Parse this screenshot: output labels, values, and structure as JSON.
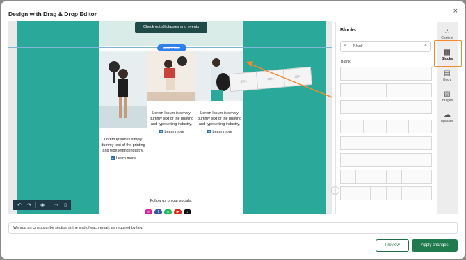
{
  "dialog": {
    "title": "Design with Drag & Drop Editor",
    "close": "×"
  },
  "email": {
    "cta_label": "Check out all classes and events",
    "drop_label": "Drop it here",
    "columns": [
      {
        "text": "Lorem Ipsum is simply dummy text of the printing and typesetting industry.",
        "link": "Learn more"
      },
      {
        "text": "Lorem Ipsum is simply dummy text of the printing and typesetting industry.",
        "link": "Learn more"
      },
      {
        "text": "Lorem Ipsum is simply dummy text of the printing and typesetting industry.",
        "link": "Learn more"
      }
    ],
    "follow_text": "Follow us on our socials:",
    "socials": [
      {
        "name": "instagram-icon",
        "color": "#d6249f"
      },
      {
        "name": "facebook-icon",
        "color": "#3b5998"
      },
      {
        "name": "spotify-icon",
        "color": "#1db954"
      },
      {
        "name": "youtube-icon",
        "color": "#e62117"
      },
      {
        "name": "tiktok-icon",
        "color": "#111111"
      }
    ]
  },
  "drag_ghost": {
    "cells": [
      "33%",
      "33%",
      "33%"
    ]
  },
  "toolbar": {
    "icons": [
      "undo-icon",
      "redo-icon",
      "preview-eye-icon",
      "desktop-icon",
      "mobile-icon"
    ]
  },
  "blocks_panel": {
    "title": "Blocks",
    "search_value": "Blank",
    "section_label": "Blank"
  },
  "sidenav": {
    "items": [
      {
        "label": "Content",
        "icon": "shapes-icon"
      },
      {
        "label": "Blocks",
        "icon": "blocks-icon",
        "active": true
      },
      {
        "label": "Body",
        "icon": "body-layout-icon"
      },
      {
        "label": "Images",
        "icon": "image-icon"
      },
      {
        "label": "Uploads",
        "icon": "cloud-upload-icon"
      }
    ]
  },
  "footer": {
    "note": "We add an Unsubscribe section at the end of each email, as required by law.",
    "preview_label": "Preview",
    "apply_label": "Apply changes"
  },
  "colors": {
    "accent": "#1f7a4d",
    "teal": "#2aa99b",
    "highlight": "#f08a2c"
  }
}
